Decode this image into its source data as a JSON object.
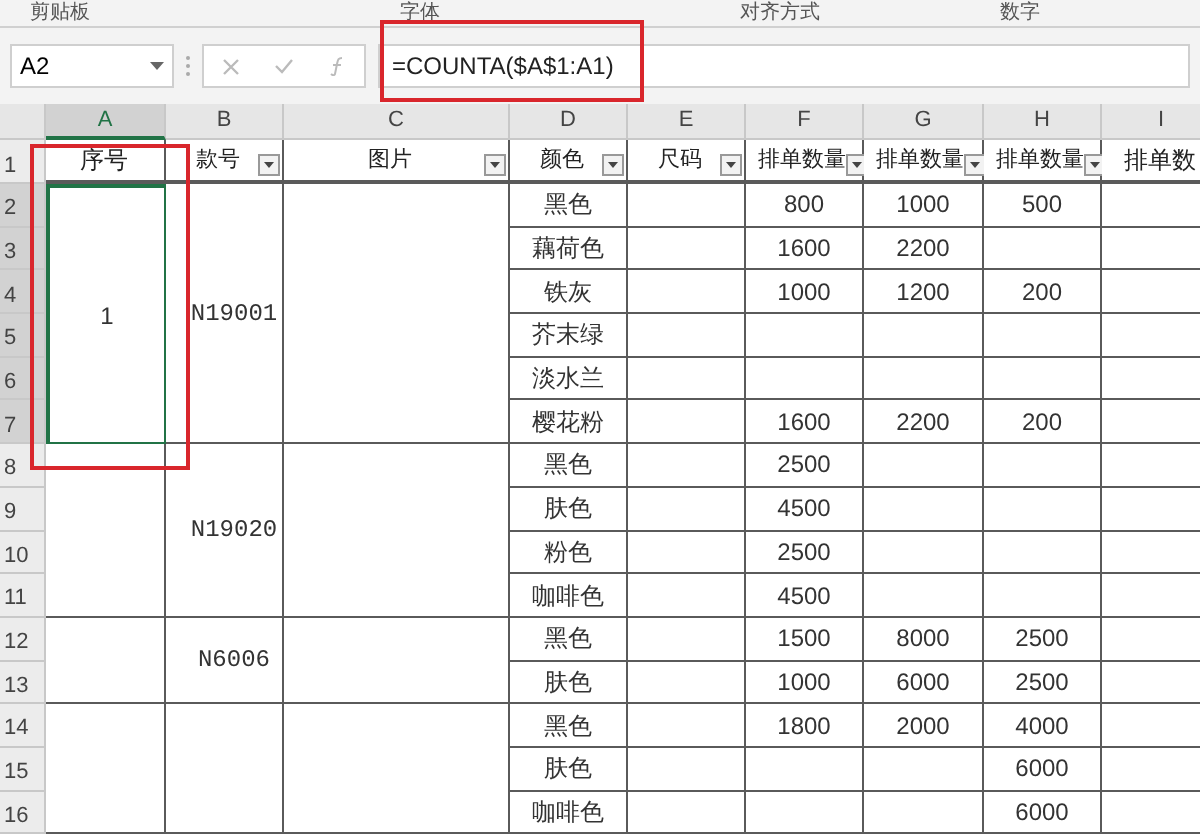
{
  "ribbon_groups": [
    "剪贴板",
    "字体",
    "对齐方式",
    "数字"
  ],
  "formula_bar": {
    "name_box": "A2",
    "formula": "=COUNTA($A$1:A1)"
  },
  "columns": [
    {
      "letter": "A",
      "selected": true
    },
    {
      "letter": "B",
      "selected": false
    },
    {
      "letter": "C",
      "selected": false
    },
    {
      "letter": "D",
      "selected": false
    },
    {
      "letter": "E",
      "selected": false
    },
    {
      "letter": "F",
      "selected": false
    },
    {
      "letter": "G",
      "selected": false
    },
    {
      "letter": "H",
      "selected": false
    },
    {
      "letter": "I",
      "selected": false
    }
  ],
  "header_row": {
    "row": "1",
    "selected": false,
    "cells": [
      {
        "text": "序号",
        "filter": false
      },
      {
        "text": "款号",
        "filter": true
      },
      {
        "text": "图片",
        "filter": true
      },
      {
        "text": "颜色",
        "filter": true
      },
      {
        "text": "尺码",
        "filter": true
      },
      {
        "text": "排单数量",
        "filter": true
      },
      {
        "text": "排单数量",
        "filter": true
      },
      {
        "text": "排单数量",
        "filter": true
      },
      {
        "text": "排单数",
        "filter": false
      }
    ]
  },
  "groups": [
    {
      "seq": "1",
      "selected": true,
      "style": "N19001",
      "rows": [
        {
          "row": "2",
          "selected": true,
          "shade": "黑色",
          "f": "800",
          "g": "1000",
          "h": "500"
        },
        {
          "row": "3",
          "selected": true,
          "shade": "藕荷色",
          "f": "1600",
          "g": "2200"
        },
        {
          "row": "4",
          "selected": true,
          "shade": "铁灰",
          "f": "1000",
          "g": "1200",
          "h": "200"
        },
        {
          "row": "5",
          "selected": true,
          "shade": "芥末绿"
        },
        {
          "row": "6",
          "selected": true,
          "shade": "淡水兰"
        },
        {
          "row": "7",
          "selected": true,
          "shade": "樱花粉",
          "f": "1600",
          "g": "2200",
          "h": "200"
        }
      ]
    },
    {
      "selected": false,
      "style": "N19020",
      "rows": [
        {
          "row": "8",
          "selected": false,
          "shade": "黑色",
          "f": "2500"
        },
        {
          "row": "9",
          "selected": false,
          "shade": "肤色",
          "f": "4500"
        },
        {
          "row": "10",
          "selected": false,
          "shade": "粉色",
          "f": "2500"
        },
        {
          "row": "11",
          "selected": false,
          "shade": "咖啡色",
          "f": "4500"
        }
      ]
    },
    {
      "selected": false,
      "style": "N6006",
      "rows": [
        {
          "row": "12",
          "selected": false,
          "shade": "黑色",
          "f": "1500",
          "g": "8000",
          "h": "2500"
        },
        {
          "row": "13",
          "selected": false,
          "shade": "肤色",
          "f": "1000",
          "g": "6000",
          "h": "2500"
        }
      ]
    },
    {
      "selected": false,
      "rows": [
        {
          "row": "14",
          "selected": false,
          "shade": "黑色",
          "f": "1800",
          "g": "2000",
          "h": "4000"
        },
        {
          "row": "15",
          "selected": false,
          "shade": "肤色",
          "h": "6000"
        },
        {
          "row": "16",
          "selected": false,
          "shade": "咖啡色",
          "h": "6000"
        }
      ]
    }
  ]
}
